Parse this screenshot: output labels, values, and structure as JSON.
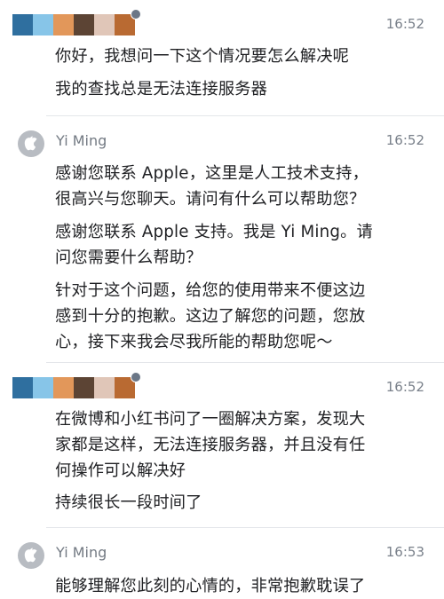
{
  "messages": [
    {
      "sender": "",
      "time": "16:52",
      "paragraphs": [
        [
          "你好，我想问一下这个情况要怎么解决呢"
        ],
        [
          "我的查找总是无法连接服务器"
        ]
      ]
    },
    {
      "sender": "Yi Ming",
      "time": "16:52",
      "paragraphs": [
        [
          "感谢您联系 Apple，这里是人工技术支持，",
          "很高兴与您聊天。请问有什么可以帮助您？"
        ],
        [
          "感谢您联系 Apple 支持。我是 Yi Ming。请",
          "问您需要什么帮助？"
        ],
        [
          "针对于这个问题，给您的使用带来不便这边",
          "感到十分的抱歉。这边了解您的问题，您放",
          "心，接下来我会尽我所能的帮助您呢～"
        ]
      ]
    },
    {
      "sender": "",
      "time": "16:52",
      "paragraphs": [
        [
          "在微博和小红书问了一圈解决方案，发现大",
          "家都是这样，无法连接服务器，并且没有任",
          "何操作可以解决好"
        ],
        [
          "持续很长一段时间了"
        ]
      ]
    },
    {
      "sender": "Yi Ming",
      "time": "16:53",
      "paragraphs": [
        [
          "能够理解您此刻的心情的，非常抱歉耽误了"
        ]
      ]
    }
  ],
  "colors": {
    "avatar_swatches": [
      "#2f6f9f",
      "#87c5e8",
      "#e2975a",
      "#5c4434",
      "#e0c6b8",
      "#b96a32"
    ],
    "apple_avatar_bg": "#b8bcc2",
    "divider": "#e4e6ea",
    "meta_text": "#737a83"
  },
  "icons": {
    "user_avatar": "pixelated-avatar-icon",
    "agent_avatar": "apple-logo-icon"
  }
}
